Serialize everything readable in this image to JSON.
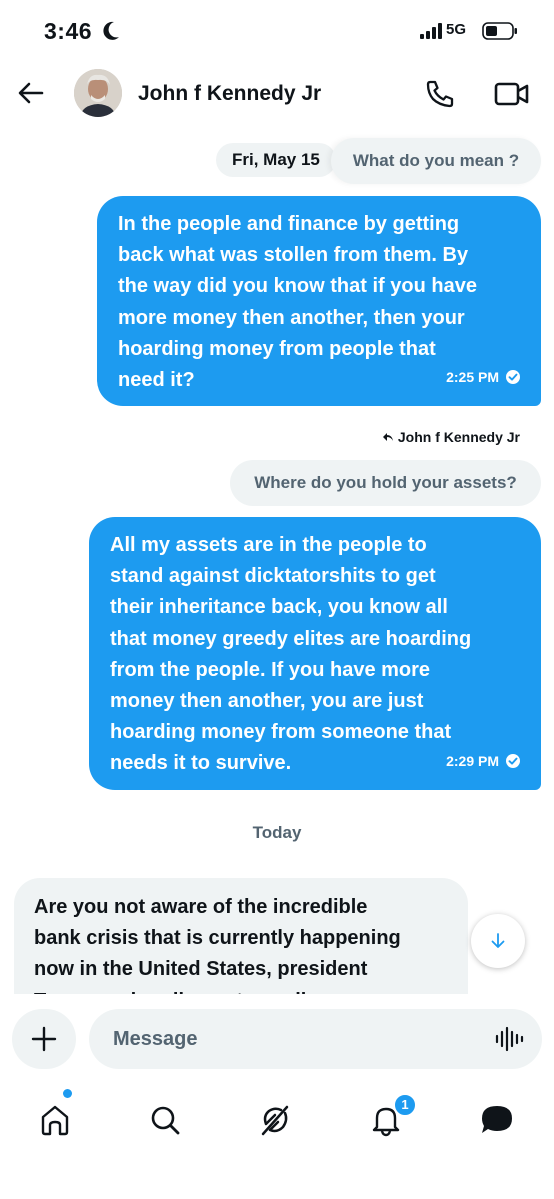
{
  "status_bar": {
    "time": "3:46",
    "network": "5G",
    "icons": [
      "moon-icon",
      "signal-icon",
      "battery-icon"
    ]
  },
  "header": {
    "contact_name": "John f Kennedy Jr",
    "icons": [
      "back-arrow-icon",
      "phone-icon",
      "video-icon"
    ]
  },
  "conversation": {
    "date_label": "Fri, May 15",
    "quoted_1": "What do you mean ?",
    "message_1": {
      "lines": [
        "In the people and finance by getting",
        "back what was stollen from them. By",
        "the way did you know that if you have",
        "more money then another, then your",
        "hoarding money from people that",
        "need it?"
      ],
      "time": "2:25 PM"
    },
    "reply_to": "John f Kennedy Jr",
    "quoted_2": "Where do you hold your assets?",
    "message_2": {
      "lines": [
        "All my assets are in the people to",
        "stand against dicktatorshits to get",
        "their inheritance back, you know all",
        "that money greedy elites are hoarding",
        "from the people. If you have more",
        "money then another, you are just",
        "hoarding money from someone that",
        "needs it to survive."
      ],
      "time": "2:29 PM"
    },
    "today_label": "Today",
    "incoming_message": {
      "lines": [
        "Are you not aware of the incredible",
        "bank crisis that is currently happening",
        "now in the United States, president",
        "Trump and parliament are all"
      ]
    }
  },
  "composer": {
    "placeholder": "Message",
    "icons": [
      "plus-icon",
      "voice-waveform-icon"
    ]
  },
  "bottom_nav": {
    "items": [
      "home",
      "search",
      "grok",
      "notifications",
      "messages"
    ],
    "notification_count": "1"
  },
  "colors": {
    "accent": "#1d9bf0",
    "bubble_gray": "#eff3f4",
    "text_primary": "#0f1419",
    "text_secondary": "#536471"
  }
}
